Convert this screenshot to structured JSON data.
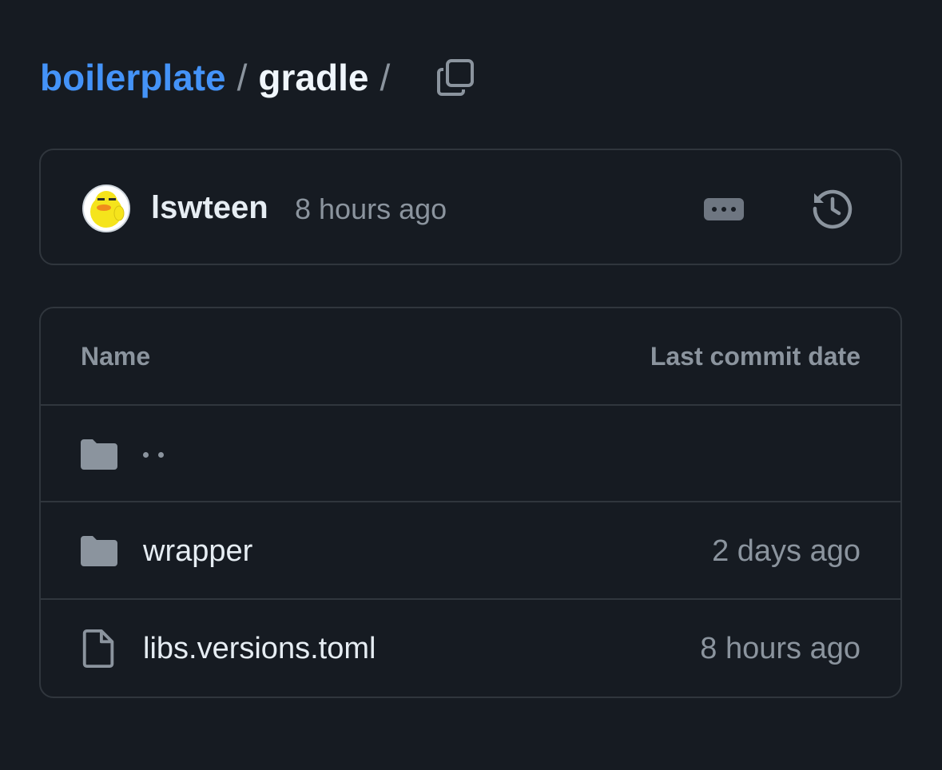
{
  "breadcrumb": {
    "repo": "boilerplate",
    "separator": "/",
    "directory": "gradle",
    "trailing_separator": "/",
    "copy_icon": "copy-icon"
  },
  "commit": {
    "author": "lswteen",
    "time": "8 hours ago",
    "avatar_icon": "duck-avatar",
    "more_icon": "ellipsis-icon",
    "history_icon": "history-icon"
  },
  "table": {
    "headers": {
      "name": "Name",
      "last_commit_date": "Last commit date"
    },
    "rows": [
      {
        "type": "parent",
        "name": "..",
        "icon": "folder-icon",
        "date": ""
      },
      {
        "type": "folder",
        "name": "wrapper",
        "icon": "folder-icon",
        "date": "2 days ago"
      },
      {
        "type": "file",
        "name": "libs.versions.toml",
        "icon": "file-icon",
        "date": "8 hours ago"
      }
    ]
  },
  "colors": {
    "background": "#161b22",
    "border": "#30363d",
    "link": "#4493f8",
    "muted": "#8b949e",
    "text": "#e6edf3"
  }
}
